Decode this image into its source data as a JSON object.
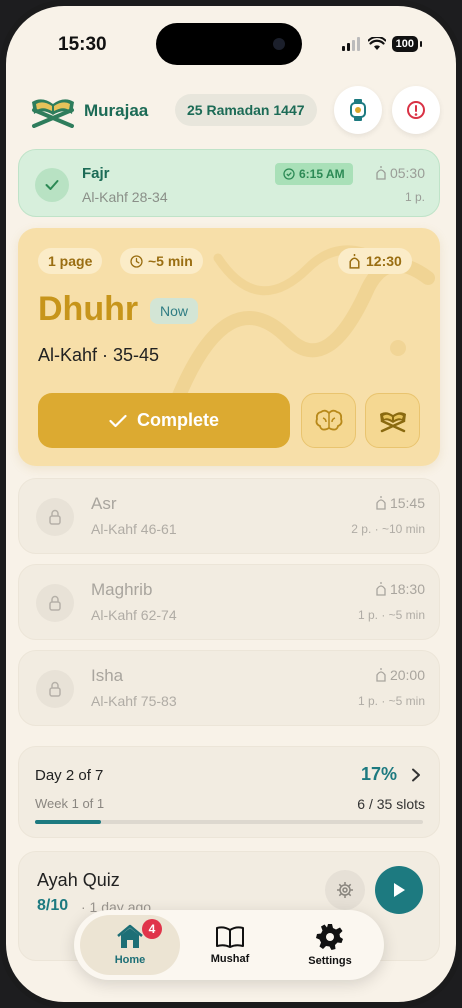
{
  "status_bar": {
    "time": "15:30",
    "battery": "100"
  },
  "header": {
    "app_name": "Murajaa",
    "hijri_date": "25 Ramadan 1447"
  },
  "prayers": {
    "fajr": {
      "name": "Fajr",
      "range": "Al-Kahf 28-34",
      "completed_at": "6:15 AM",
      "time": "05:30",
      "pages": "1 p."
    },
    "dhuhr": {
      "name": "Dhuhr",
      "badge": "Now",
      "range": "Al-Kahf · 35-45",
      "pages": "1 page",
      "duration": "~5 min",
      "time": "12:30",
      "complete_label": "Complete"
    },
    "asr": {
      "name": "Asr",
      "range": "Al-Kahf 46-61",
      "time": "15:45",
      "meta": "2 p. · ~10 min"
    },
    "maghrib": {
      "name": "Maghrib",
      "range": "Al-Kahf 62-74",
      "time": "18:30",
      "meta": "1 p. · ~5 min"
    },
    "isha": {
      "name": "Isha",
      "range": "Al-Kahf 75-83",
      "time": "20:00",
      "meta": "1 p. · ~5 min"
    }
  },
  "progress": {
    "day": "Day 2 of 7",
    "percent": "17%",
    "percent_value": 0.17,
    "week": "Week 1 of 1",
    "slots": "6 / 35 slots"
  },
  "quiz": {
    "title": "Ayah Quiz",
    "score": "8/10",
    "last": "· 1 day ago"
  },
  "tabbar": {
    "home": "Home",
    "home_badge": "4",
    "mushaf": "Mushaf",
    "settings": "Settings"
  },
  "colors": {
    "brand": "#1c6b56",
    "accent": "#dcaa31",
    "teal": "#1d7a80",
    "badge": "#e0344a"
  },
  "icons": [
    "quran-logo-icon",
    "prayer-watch-icon",
    "alert-icon",
    "check-icon",
    "clock-icon",
    "mosque-icon",
    "brain-icon",
    "quran-stand-icon",
    "lock-icon",
    "chevron-right-icon",
    "gear-icon",
    "play-icon",
    "home-icon",
    "book-icon",
    "settings-icon"
  ]
}
